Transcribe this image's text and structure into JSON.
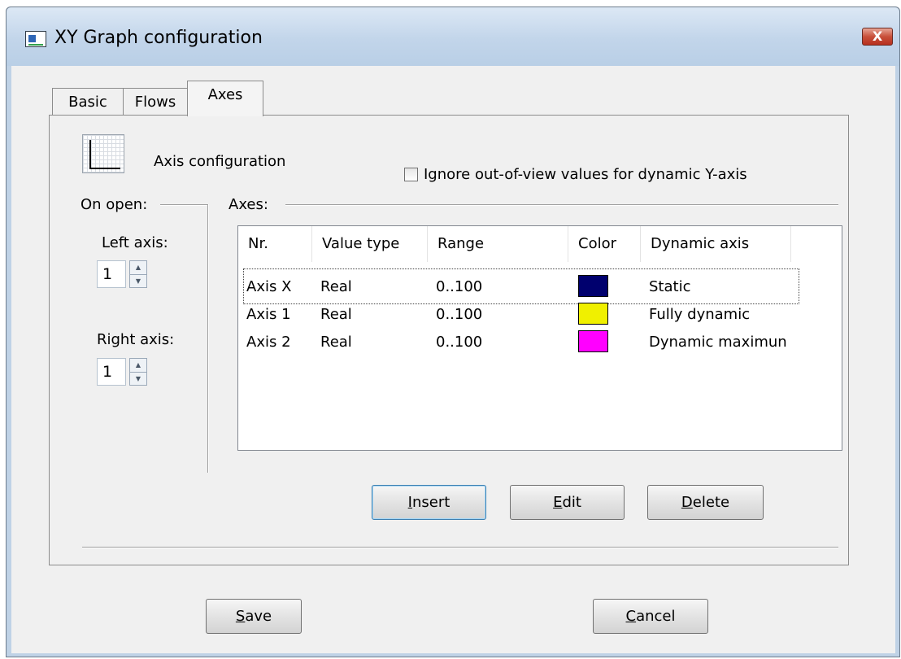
{
  "window": {
    "title": "XY Graph configuration",
    "close_glyph": "X"
  },
  "tabs": [
    {
      "label": "Basic"
    },
    {
      "label": "Flows"
    },
    {
      "label": "Axes"
    }
  ],
  "axes_tab": {
    "heading": "Axis configuration",
    "ignore_checkbox_label": "Ignore out-of-view values for dynamic Y-axis",
    "ignore_checked": false,
    "on_open_group": "On open:",
    "left_axis_label": "Left axis:",
    "left_axis_value": "1",
    "right_axis_label": "Right axis:",
    "right_axis_value": "1",
    "axes_group": "Axes:",
    "columns": [
      "Nr.",
      "Value type",
      "Range",
      "Color",
      "Dynamic axis"
    ],
    "rows": [
      {
        "nr": "Axis X",
        "value_type": "Real",
        "range": "0..100",
        "color": "#00006e",
        "dynamic": "Static"
      },
      {
        "nr": "Axis 1",
        "value_type": "Real",
        "range": "0..100",
        "color": "#f0f000",
        "dynamic": "Fully dynamic"
      },
      {
        "nr": "Axis 2",
        "value_type": "Real",
        "range": "0..100",
        "color": "#ff00ff",
        "dynamic": "Dynamic maximun"
      }
    ],
    "buttons": {
      "insert": {
        "accel": "I",
        "rest": "nsert"
      },
      "edit": {
        "accel": "E",
        "rest": "dit"
      },
      "delete": {
        "accel": "D",
        "rest": "elete"
      }
    }
  },
  "footer": {
    "save": {
      "accel": "S",
      "rest": "ave"
    },
    "cancel": {
      "accel": "C",
      "rest": "ancel"
    }
  }
}
